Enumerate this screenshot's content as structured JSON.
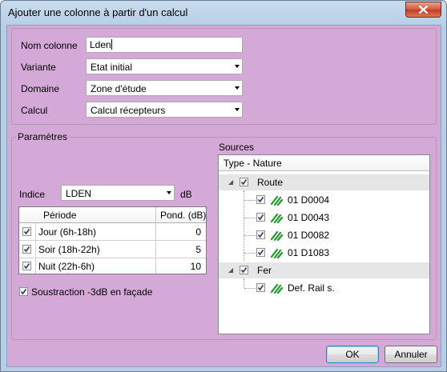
{
  "window": {
    "title": "Ajouter une colonne à partir d'un calcul"
  },
  "form": {
    "nom_label": "Nom colonne",
    "nom_value": "Lden",
    "variante_label": "Variante",
    "variante_value": "Etat initial",
    "domaine_label": "Domaine",
    "domaine_value": "Zone d'étude",
    "calcul_label": "Calcul",
    "calcul_value": "Calcul récepteurs"
  },
  "parametres": {
    "title": "Paramètres",
    "indice_label": "Indice",
    "indice_value": "LDEN",
    "unit": "dB",
    "table": {
      "headers": [
        "Période",
        "Pond. (dB)"
      ],
      "rows": [
        {
          "periode": "Jour (6h-18h)",
          "pond": "0"
        },
        {
          "periode": "Soir (18h-22h)",
          "pond": "5"
        },
        {
          "periode": "Nuit (22h-6h)",
          "pond": "10"
        }
      ]
    },
    "soustraction_label": "Soustraction -3dB en façade"
  },
  "sources": {
    "title": "Sources",
    "header": "Type - Nature",
    "groups": [
      {
        "name": "Route",
        "items": [
          "01 D0004",
          "01 D0043",
          "01 D0082",
          "01 D1083"
        ]
      },
      {
        "name": "Fer",
        "items": [
          "Def. Rail s."
        ]
      }
    ]
  },
  "buttons": {
    "ok": "OK",
    "cancel": "Annuler"
  },
  "colors": {
    "client_bg": "#d4a9d8",
    "grid_group_bg": "#e6e6e6",
    "leaf_icon": "#1f9a2a"
  }
}
